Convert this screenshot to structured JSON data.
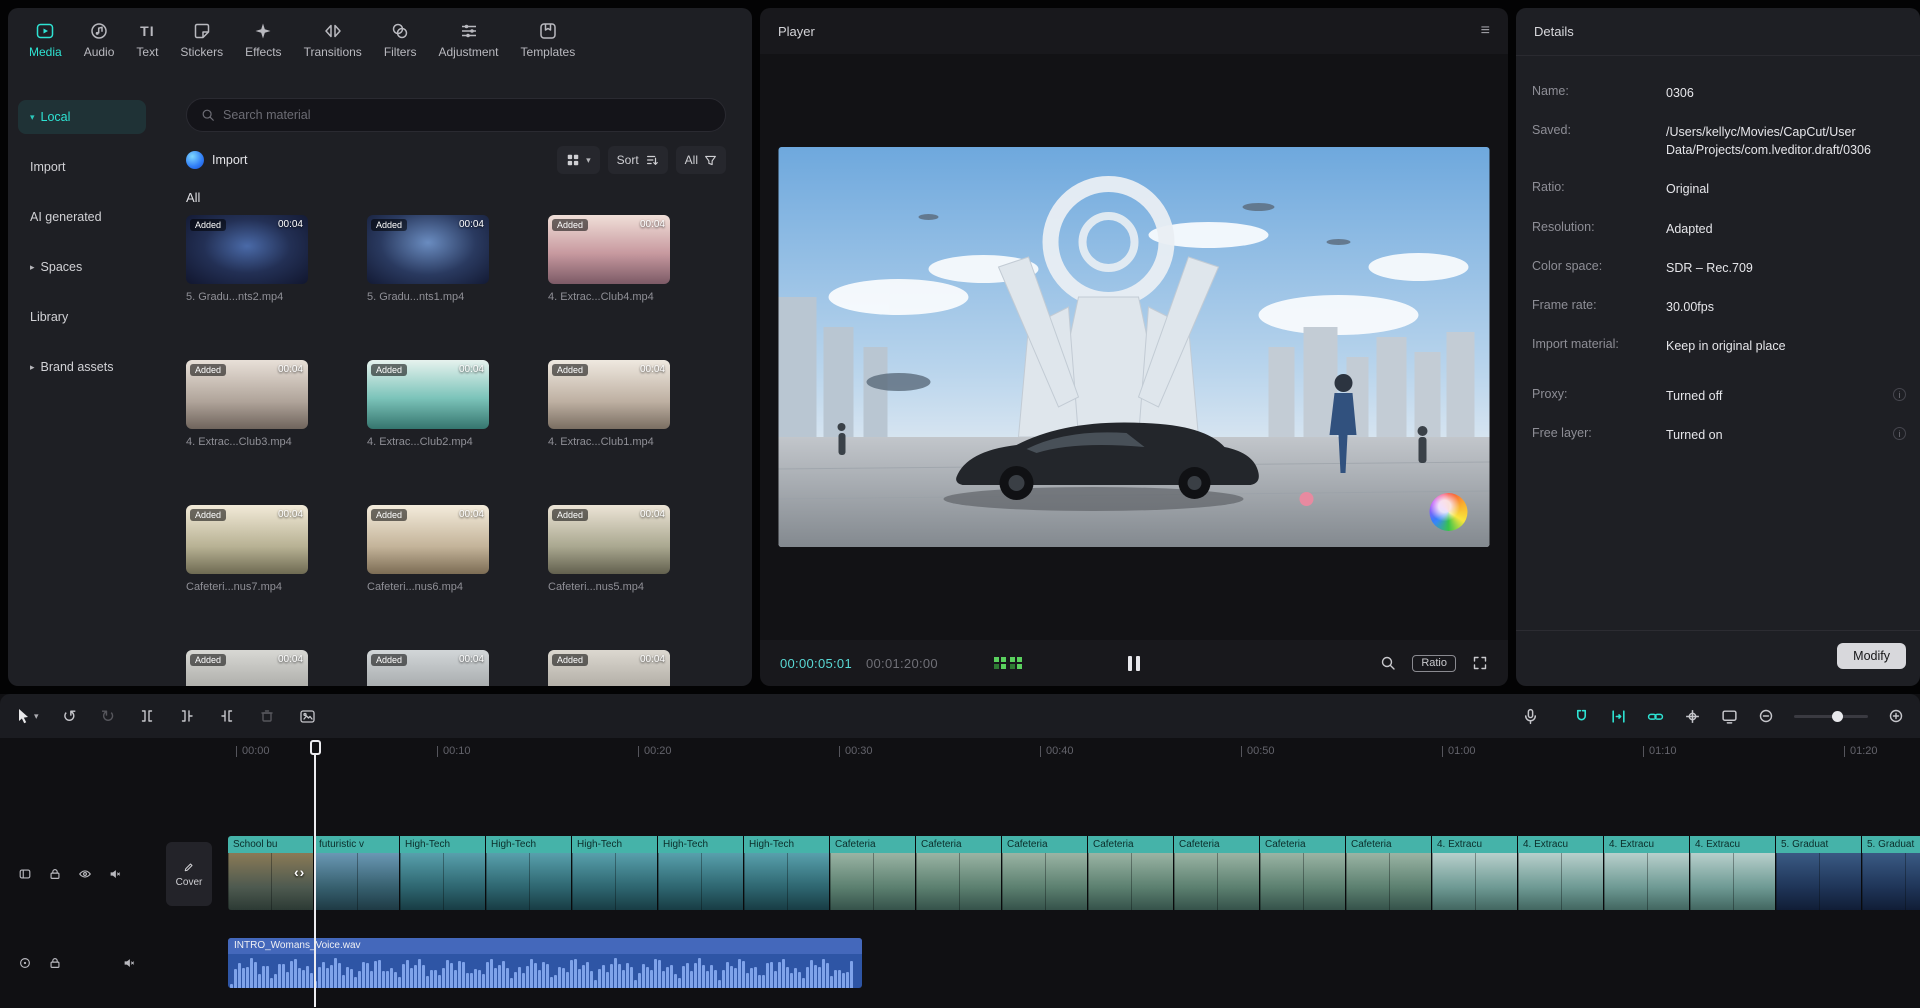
{
  "accent": "#2ee3d3",
  "icons": {
    "menu": "≡",
    "undo": "↺",
    "redo": "↻",
    "chevron_down": "▾",
    "chevron_right": "▸",
    "text_tab": "TI",
    "trim_handles": "‹›"
  },
  "tabs": [
    {
      "label": "Media",
      "active": true
    },
    {
      "label": "Audio"
    },
    {
      "label": "Text"
    },
    {
      "label": "Stickers"
    },
    {
      "label": "Effects"
    },
    {
      "label": "Transitions"
    },
    {
      "label": "Filters"
    },
    {
      "label": "Adjustment"
    },
    {
      "label": "Templates"
    }
  ],
  "sidebar": [
    {
      "label": "Local",
      "active": true
    },
    {
      "label": "Import"
    },
    {
      "label": "AI generated"
    },
    {
      "label": "Spaces"
    },
    {
      "label": "Library"
    },
    {
      "label": "Brand assets"
    }
  ],
  "media": {
    "search_placeholder": "Search material",
    "import_label": "Import",
    "sort_label": "Sort",
    "filter_all_label": "All",
    "section_label": "All",
    "clips": [
      {
        "name": "5. Gradu...nts2.mp4",
        "duration": "00:04",
        "badge": "Added",
        "thumb": "stadium1"
      },
      {
        "name": "5. Gradu...nts1.mp4",
        "duration": "00:04",
        "badge": "Added",
        "thumb": "stadium2"
      },
      {
        "name": "4. Extrac...Club4.mp4",
        "duration": "00:04",
        "badge": "Added",
        "thumb": "club1"
      },
      {
        "name": "4. Extrac...Club3.mp4",
        "duration": "00:04",
        "badge": "Added",
        "thumb": "club2"
      },
      {
        "name": "4. Extrac...Club2.mp4",
        "duration": "00:04",
        "badge": "Added",
        "thumb": "pool"
      },
      {
        "name": "4. Extrac...Club1.mp4",
        "duration": "00:04",
        "badge": "Added",
        "thumb": "club3"
      },
      {
        "name": "Cafeteri...nus7.mp4",
        "duration": "00:04",
        "badge": "Added",
        "thumb": "cafe1"
      },
      {
        "name": "Cafeteri...nus6.mp4",
        "duration": "00:04",
        "badge": "Added",
        "thumb": "cafe2"
      },
      {
        "name": "Cafeteri...nus5.mp4",
        "duration": "00:04",
        "badge": "Added",
        "thumb": "cafe3"
      },
      {
        "name": "",
        "duration": "00:04",
        "badge": "Added",
        "thumb": "cut1"
      },
      {
        "name": "",
        "duration": "00:04",
        "badge": "Added",
        "thumb": "cut2"
      },
      {
        "name": "",
        "duration": "00:04",
        "badge": "Added",
        "thumb": "cut3"
      }
    ]
  },
  "player": {
    "title": "Player",
    "current_time": "00:00:05:01",
    "total_time": "00:01:20:00",
    "ratio_label": "Ratio"
  },
  "details": {
    "title": "Details",
    "fields": [
      {
        "label": "Name:",
        "value": "0306"
      },
      {
        "label": "Saved:",
        "value": "/Users/kellyc/Movies/CapCut/User Data/Projects/com.lveditor.draft/0306"
      },
      {
        "label": "Ratio:",
        "value": "Original"
      },
      {
        "label": "Resolution:",
        "value": "Adapted"
      },
      {
        "label": "Color space:",
        "value": "SDR – Rec.709"
      },
      {
        "label": "Frame rate:",
        "value": "30.00fps"
      },
      {
        "label": "Import material:",
        "value": "Keep in original place"
      },
      {
        "label": "Proxy:",
        "value": "Turned off",
        "info": true
      },
      {
        "label": "Free layer:",
        "value": "Turned on",
        "info": true
      }
    ],
    "modify_label": "Modify"
  },
  "timeline": {
    "ruler": [
      "00:00",
      "00:10",
      "00:20",
      "00:30",
      "00:40",
      "00:50",
      "01:00",
      "01:10",
      "01:20"
    ],
    "cover_label": "Cover",
    "audio_clip": "INTRO_Womans_Voice.wav",
    "video_clips": [
      {
        "label": "School bu",
        "style": "school"
      },
      {
        "label": "futuristic v",
        "style": "futur"
      },
      {
        "label": "High-Tech",
        "style": "tech"
      },
      {
        "label": "High-Tech",
        "style": "tech"
      },
      {
        "label": "High-Tech",
        "style": "tech"
      },
      {
        "label": "High-Tech",
        "style": "tech"
      },
      {
        "label": "High-Tech",
        "style": "tech"
      },
      {
        "label": "Cafeteria",
        "style": "cafe"
      },
      {
        "label": "Cafeteria",
        "style": "cafe"
      },
      {
        "label": "Cafeteria",
        "style": "cafe"
      },
      {
        "label": "Cafeteria",
        "style": "cafe"
      },
      {
        "label": "Cafeteria",
        "style": "cafe"
      },
      {
        "label": "Cafeteria",
        "style": "cafe"
      },
      {
        "label": "Cafeteria",
        "style": "cafe"
      },
      {
        "label": "4. Extracu",
        "style": "extrac"
      },
      {
        "label": "4. Extracu",
        "style": "extrac"
      },
      {
        "label": "4. Extracu",
        "style": "extrac"
      },
      {
        "label": "4. Extracu",
        "style": "extrac"
      },
      {
        "label": "5. Graduat",
        "style": "grad"
      },
      {
        "label": "5. Graduat",
        "style": "grad"
      }
    ]
  }
}
